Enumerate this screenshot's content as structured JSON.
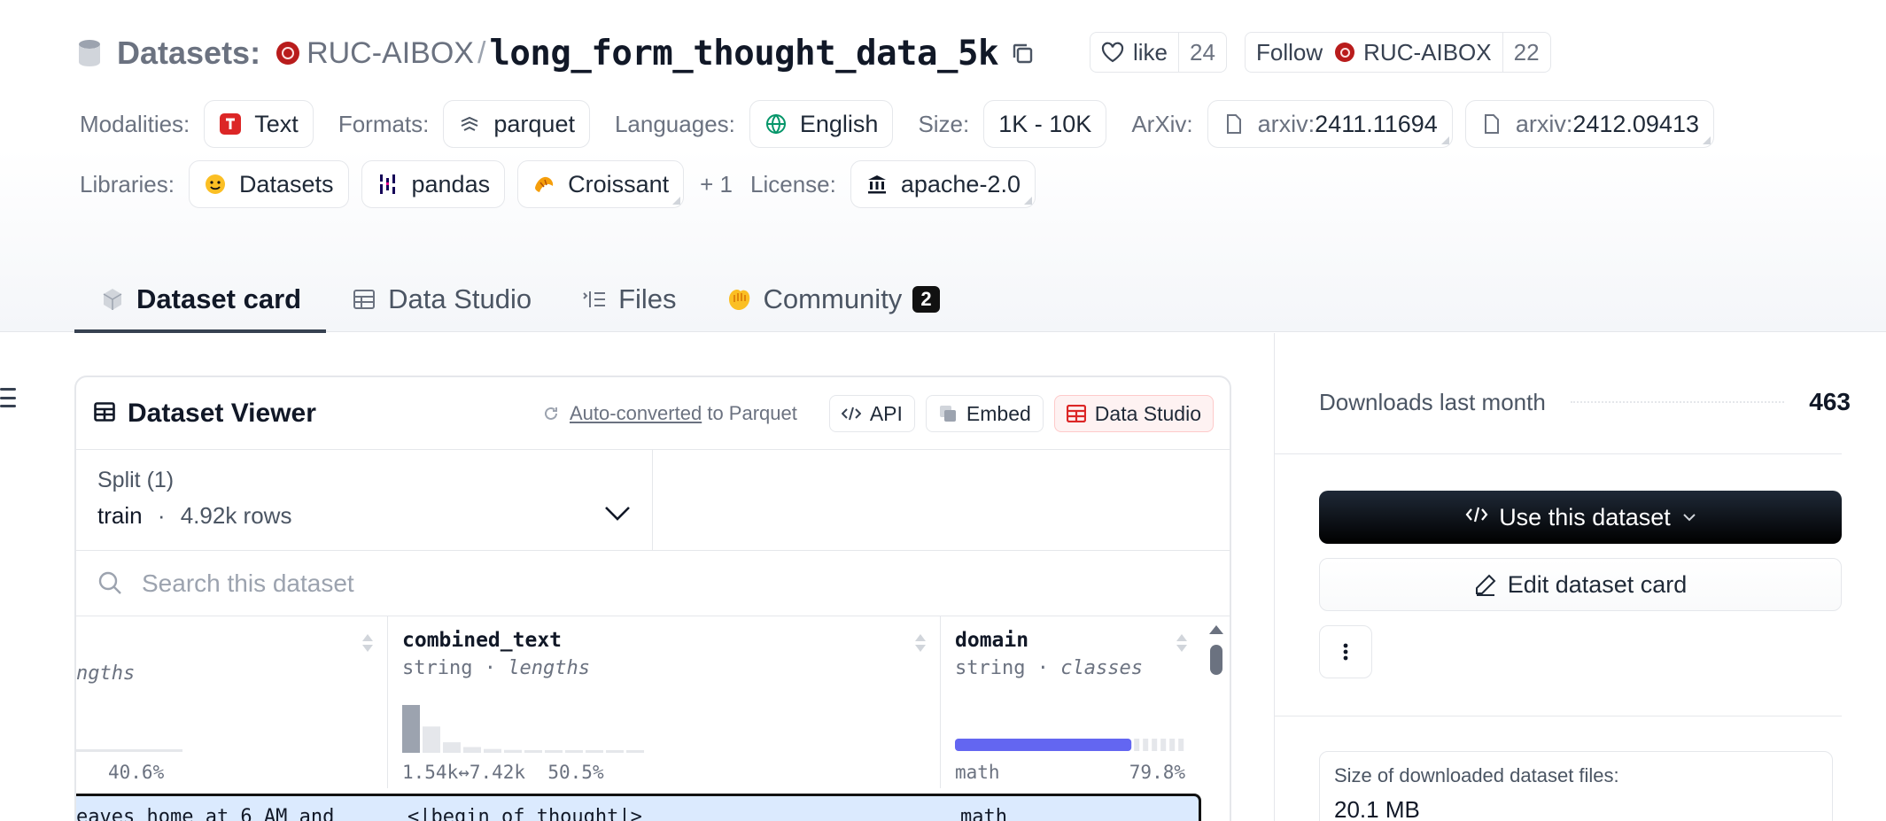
{
  "header": {
    "prefix": "Datasets:",
    "org": "RUC-AIBOX",
    "slash": "/",
    "repo": "long_form_thought_data_5k",
    "like_label": "like",
    "like_count": "24",
    "follow_label": "Follow",
    "follow_org": "RUC-AIBOX",
    "follow_count": "22"
  },
  "meta": {
    "modalities_label": "Modalities:",
    "modality": "Text",
    "formats_label": "Formats:",
    "format": "parquet",
    "languages_label": "Languages:",
    "language": "English",
    "size_label": "Size:",
    "size": "1K - 10K",
    "arxiv_label": "ArXiv:",
    "arxiv": [
      {
        "prefix": "arxiv:",
        "id": "2411.11694"
      },
      {
        "prefix": "arxiv:",
        "id": "2412.09413"
      }
    ],
    "libraries_label": "Libraries:",
    "libraries": [
      "Datasets",
      "pandas",
      "Croissant"
    ],
    "more_libraries": "+ 1",
    "license_label": "License:",
    "license": "apache-2.0"
  },
  "tabs": [
    {
      "label": "Dataset card",
      "icon": "cube-icon"
    },
    {
      "label": "Data Studio",
      "icon": "table-icon"
    },
    {
      "label": "Files",
      "icon": "files-icon"
    },
    {
      "label": "Community",
      "icon": "community-icon",
      "badge": "2"
    }
  ],
  "viewer": {
    "title": "Dataset Viewer",
    "auto_converted": "Auto-converted",
    "to_parquet": "to Parquet",
    "api_label": "API",
    "embed_label": "Embed",
    "studio_label": "Data Studio",
    "split_label": "Split (1)",
    "split_name": "train",
    "split_sep": "·",
    "split_rows": "4.92k rows",
    "search_placeholder": "Search this dataset",
    "columns": [
      {
        "name": "",
        "type_partial": "ngths",
        "stat_right": "40.6%"
      },
      {
        "name": "combined_text",
        "type": "string",
        "sep": "·",
        "kind": "lengths",
        "range": "1.54k↔7.42k",
        "pct": "50.5%",
        "hist": [
          1.0,
          0.55,
          0.22,
          0.12,
          0.08,
          0.06,
          0.05,
          0.04,
          0.03,
          0.03,
          0.02,
          0.02
        ]
      },
      {
        "name": "domain",
        "type": "string",
        "sep": "·",
        "kind": "classes",
        "top_class": "math",
        "pct": "79.8%",
        "share": 0.798
      }
    ],
    "first_row": {
      "col0": "eaves home at 6 AM and",
      "combined_text": "<|begin_of_thought|>",
      "domain": "math"
    }
  },
  "sidebar": {
    "downloads_label": "Downloads last month",
    "downloads_value": "463",
    "use_label": "Use this dataset",
    "edit_label": "Edit dataset card",
    "size_label": "Size of downloaded dataset files:",
    "size_value": "20.1 MB"
  },
  "colors": {
    "accent_blue": "#6366f1",
    "highlight_row": "#dbeafe",
    "hist_bar": "#9ca3af",
    "primary_btn": "#000000"
  }
}
